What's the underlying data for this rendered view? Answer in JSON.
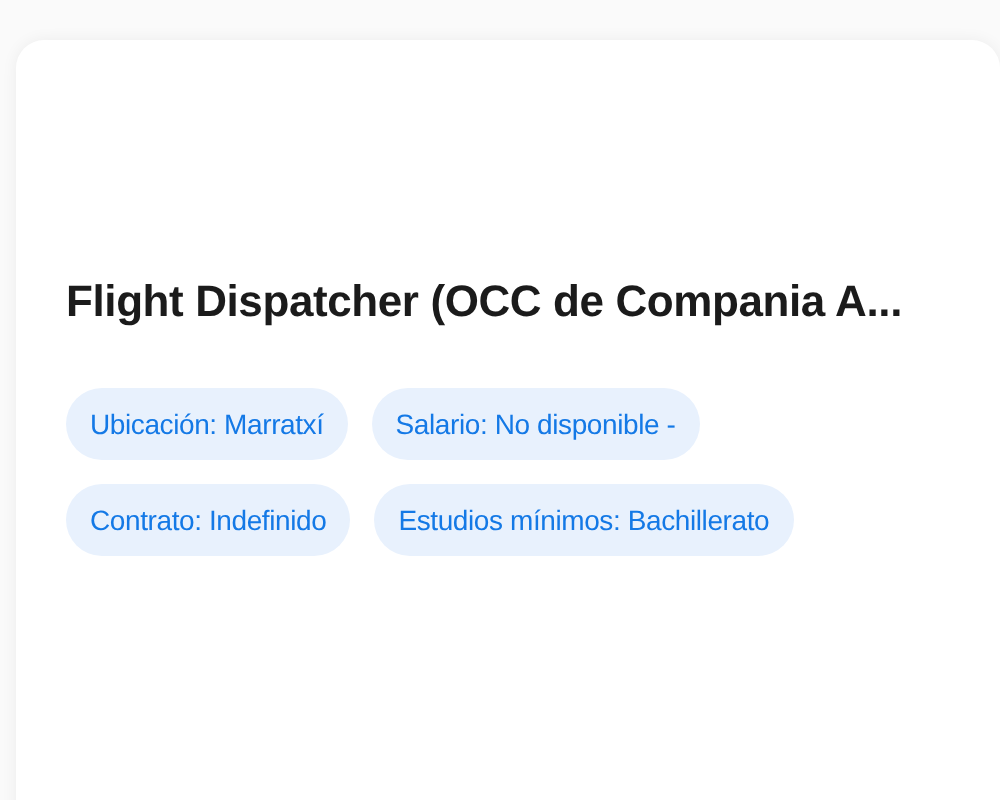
{
  "job": {
    "title": "Flight Dispatcher (OCC de Compania A...",
    "tags": [
      {
        "label": "Ubicación: Marratxí"
      },
      {
        "label": "Salario: No disponible -"
      },
      {
        "label": "Contrato: Indefinido"
      },
      {
        "label": "Estudios mínimos: Bachillerato"
      }
    ]
  }
}
